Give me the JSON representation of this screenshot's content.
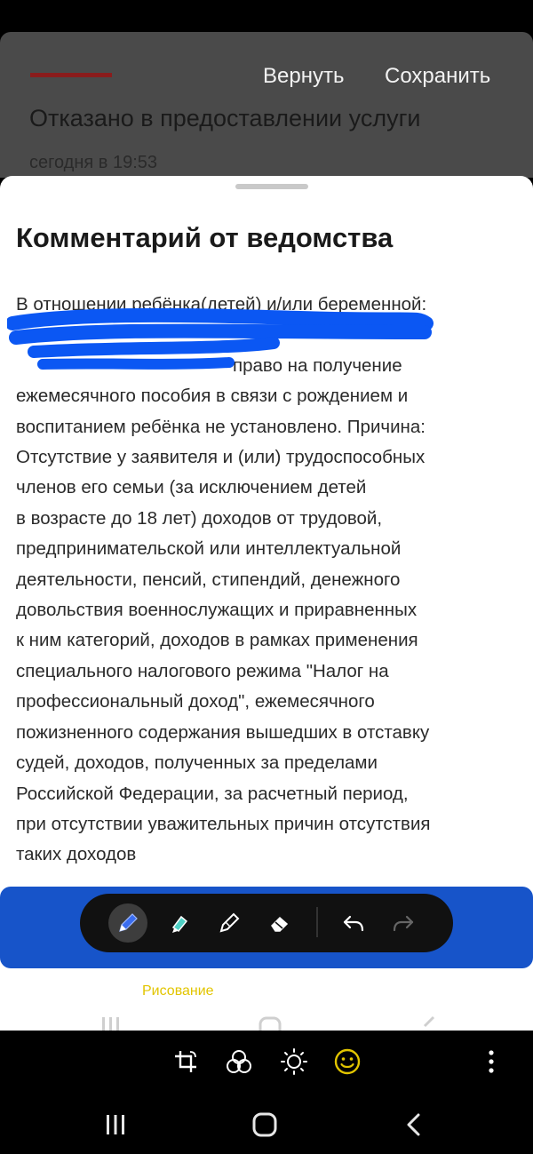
{
  "header": {
    "undo_label": "Вернуть",
    "save_label": "Сохранить",
    "title": "Отказано в предоставлении услуги",
    "time": "сегодня в 19:53"
  },
  "sheet": {
    "title": "Комментарий от ведомства",
    "lines": [
      "В отношении ребёнка(детей) и/или беременной:",
      "право на получение",
      "ежемесячного пособия в связи с рождением и",
      "воспитанием ребёнка не установлено. Причина:",
      "Отсутствие у заявителя и (или) трудоспособных",
      "членов его семьи (за исключением детей",
      "в возрасте до 18 лет) доходов от трудовой,",
      "предпринимательской или интеллектуальной",
      "деятельности, пенсий, стипендий, денежного",
      "довольствия военнослужащих и приравненных",
      "к ним категорий, доходов в рамках применения",
      "специального налогового режима \"Налог на",
      "профессиональный доход\", ежемесячного",
      "пожизненного содержания вышедших в отставку",
      "судей, доходов, полученных за пределами",
      "Российской Федерации, за расчетный период,",
      "при отсутствии уважительных причин отсутствия",
      "таких доходов"
    ]
  },
  "drawing": {
    "mode_label": "Рисование",
    "tools": [
      "pen-icon",
      "highlighter-icon",
      "pencil-icon",
      "eraser-icon",
      "undo-icon",
      "redo-icon"
    ],
    "active_tool": "pen-icon",
    "band_color": "#1754c9",
    "label_color": "#e2c500"
  },
  "editor": {
    "icons": [
      "crop-rotate-icon",
      "filters-icon",
      "brightness-icon",
      "sticker-icon"
    ]
  },
  "navigation": {
    "icons": [
      "recent-apps-icon",
      "home-icon",
      "back-icon"
    ]
  }
}
